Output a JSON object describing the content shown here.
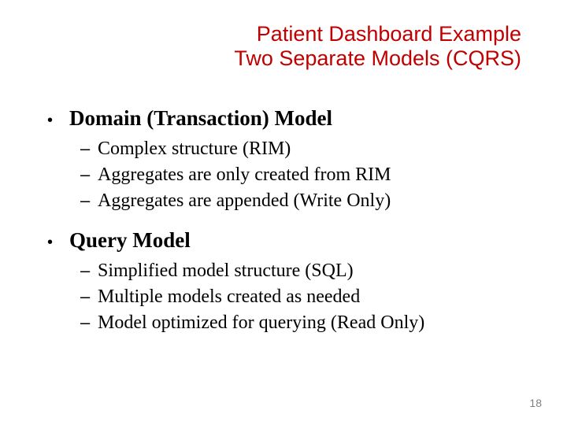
{
  "title": {
    "line1": "Patient Dashboard Example",
    "line2": "Two Separate Models (CQRS)"
  },
  "content": {
    "items": [
      {
        "label": "Domain (Transaction) Model",
        "sub": [
          "Complex structure (RIM)",
          "Aggregates are only created from RIM",
          "Aggregates are appended (Write Only)"
        ]
      },
      {
        "label": "Query Model",
        "sub": [
          "Simplified model structure (SQL)",
          "Multiple models created as needed",
          "Model optimized for querying (Read Only)"
        ]
      }
    ]
  },
  "page_number": "18"
}
